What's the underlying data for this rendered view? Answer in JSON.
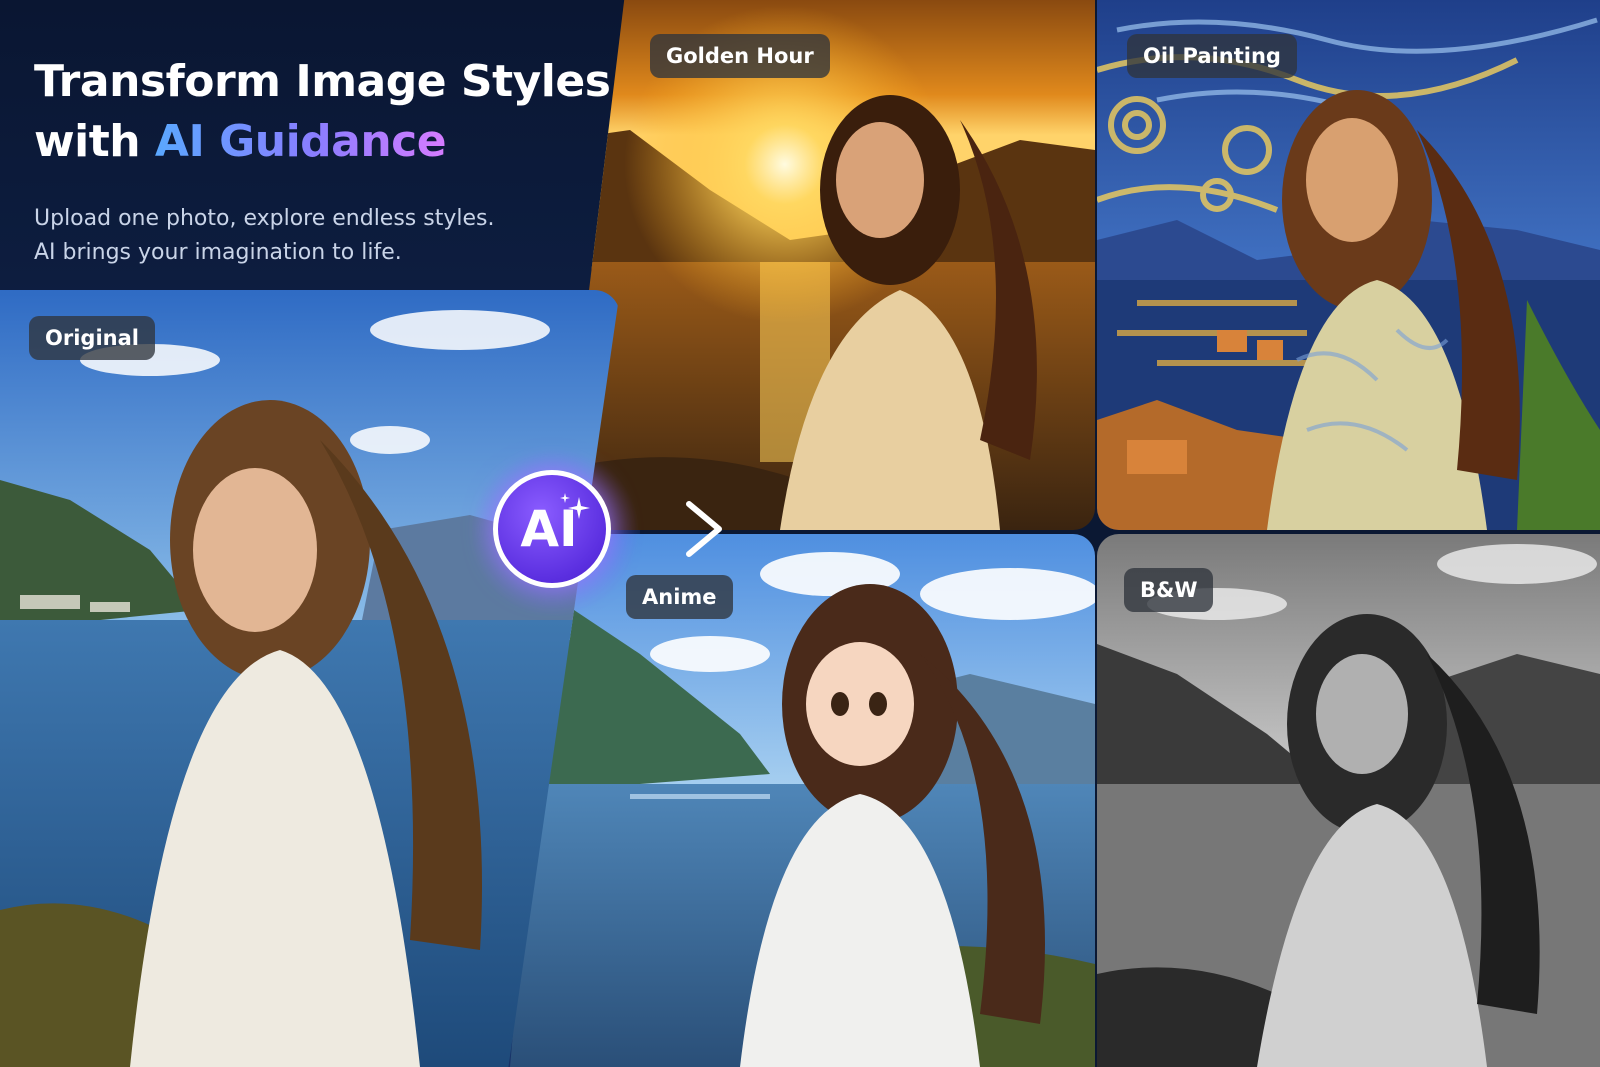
{
  "hero": {
    "title_line1": "Transform Image Styles",
    "title_line2_prefix": "with ",
    "title_line2_highlight": "AI Guidance",
    "subtitle_line1": "Upload one photo, explore endless styles.",
    "subtitle_line2": "AI brings your imagination to life."
  },
  "labels": {
    "original": "Original",
    "golden_hour": "Golden Hour",
    "oil_painting": "Oil Painting",
    "anime": "Anime",
    "bw": "B&W"
  },
  "badge": {
    "text": "AI"
  },
  "colors": {
    "background": "#0b1833",
    "accent_gradient_start": "#5aa8ff",
    "accent_gradient_end": "#d67cff",
    "badge_purple": "#5b2fe0",
    "label_chip": "#30343c"
  },
  "icons": {
    "badge_sparkle": "sparkle-icon",
    "transform_arrow": "arrow-right-icon"
  }
}
